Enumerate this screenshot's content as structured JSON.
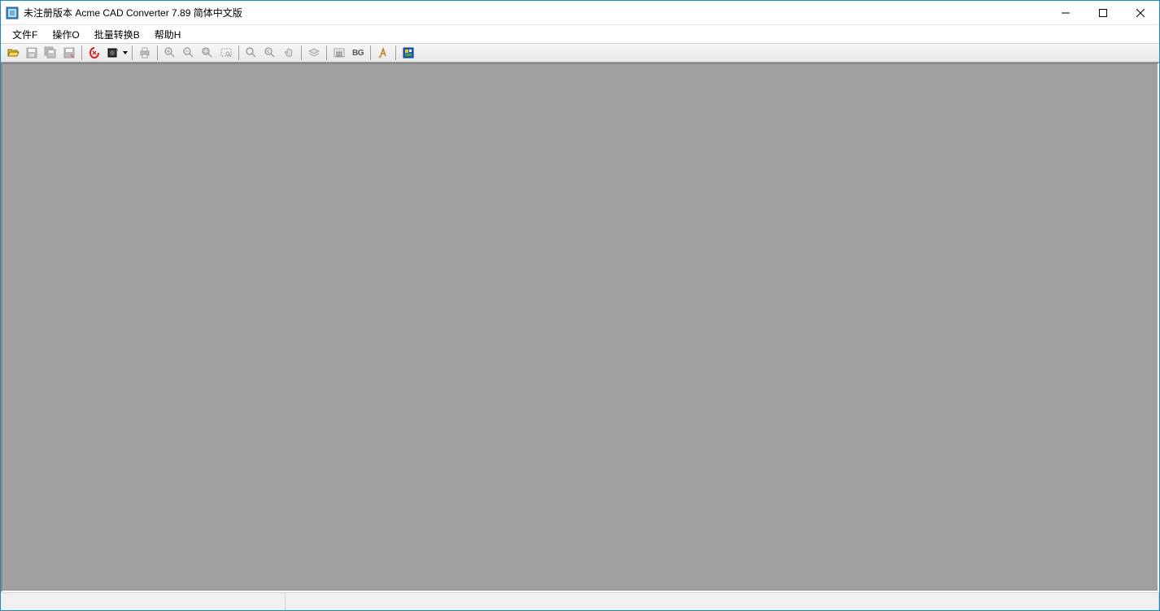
{
  "titlebar": {
    "title": "未注册版本 Acme CAD Converter 7.89 简体中文版"
  },
  "menubar": {
    "items": [
      {
        "label": "文件F"
      },
      {
        "label": "操作O"
      },
      {
        "label": "批量转换B"
      },
      {
        "label": "帮助H"
      }
    ]
  },
  "toolbar": {
    "bg_label": "BG",
    "icons": {
      "open": "open-icon",
      "save": "save-icon",
      "save_all": "save-all-icon",
      "save_as": "save-as-icon",
      "pdf": "pdf-icon",
      "export": "export-icon",
      "print": "print-icon",
      "zoom_in": "zoom-in-icon",
      "zoom_out": "zoom-out-icon",
      "zoom_fit": "zoom-fit-icon",
      "zoom_window": "zoom-window-icon",
      "zoom_extent": "zoom-extent-icon",
      "zoom_prev": "zoom-prev-icon",
      "pan": "pan-icon",
      "layer": "layer-icon",
      "line_width": "line-width-icon",
      "bg_color": "bg-color-icon",
      "font": "font-icon",
      "register": "register-icon"
    }
  },
  "statusbar": {
    "text": ""
  }
}
